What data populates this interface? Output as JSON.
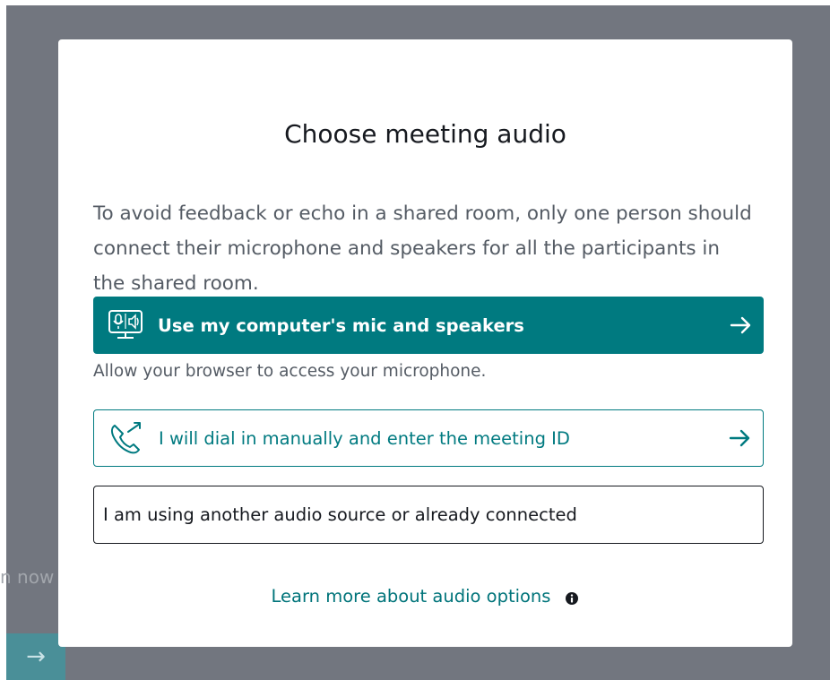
{
  "background": {
    "partial_text": "n now",
    "join_button_icon": "arrow-right-icon"
  },
  "modal": {
    "title": "Choose meeting audio",
    "description": "To avoid feedback or echo in a shared room, only one person should connect their microphone and speakers for all the participants in the shared room.",
    "options": {
      "computer_audio": {
        "label": "Use my computer's mic and speakers",
        "icon": "computer-mic-speaker-icon",
        "arrow_icon": "arrow-right-icon"
      },
      "computer_audio_hint": "Allow your browser to access your microphone.",
      "dial_in": {
        "label": "I will dial in manually and enter the meeting ID",
        "icon": "phone-dial-out-icon",
        "arrow_icon": "arrow-right-icon"
      },
      "other_source": {
        "label": "I am using another audio source or already connected"
      }
    },
    "learn_more": {
      "label": "Learn more about audio options",
      "icon": "info-icon"
    }
  },
  "colors": {
    "accent": "#007a80",
    "overlay": "#72767f",
    "text_primary": "#16191f",
    "text_secondary": "#545b64",
    "link": "#00747a"
  }
}
